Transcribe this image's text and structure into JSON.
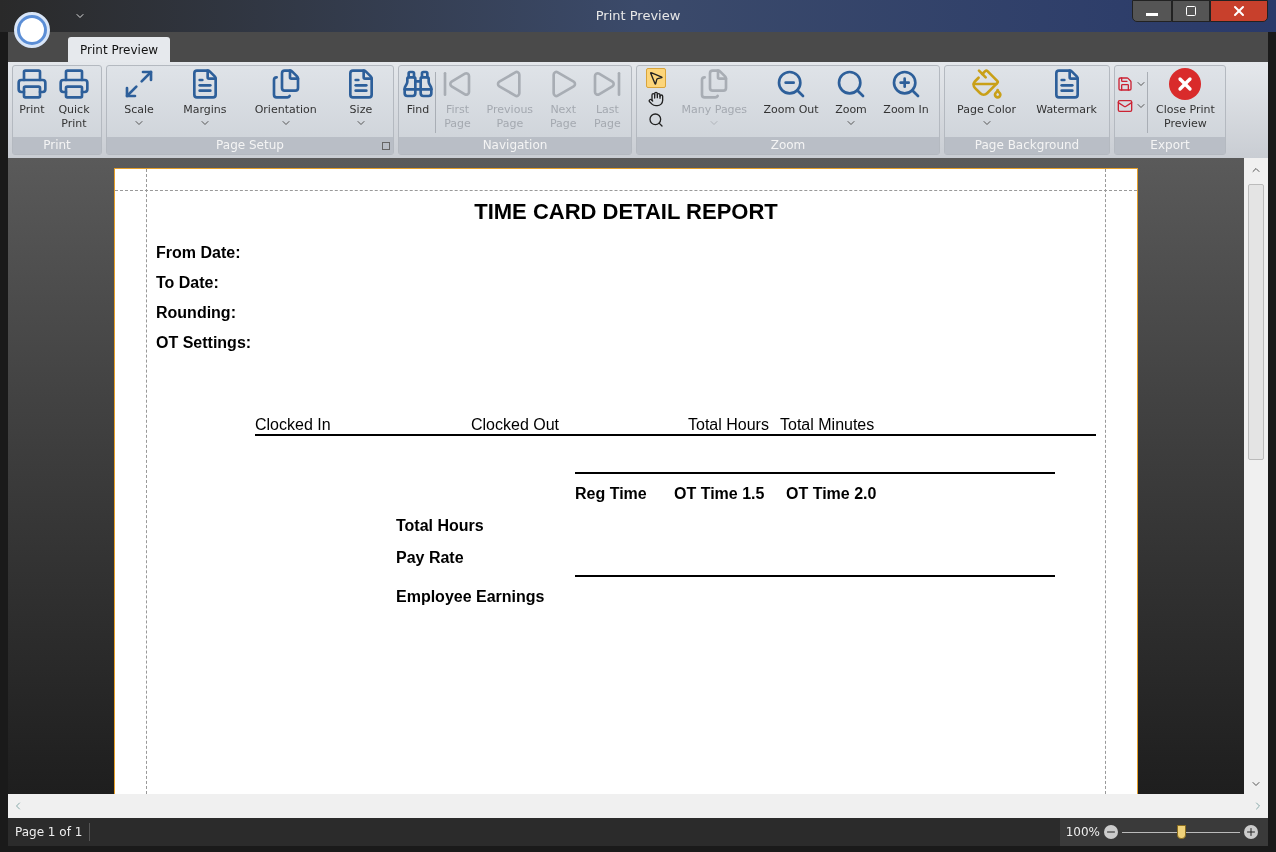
{
  "window": {
    "title": "Print Preview"
  },
  "tabs": [
    {
      "label": "Print Preview",
      "selected": true
    }
  ],
  "ribbon": [
    {
      "label": "Print",
      "has_launcher": false,
      "buttons": [
        {
          "kind": "large",
          "label": "Print",
          "disabled": false,
          "dropdown": false
        },
        {
          "kind": "large",
          "label": "Quick Print",
          "disabled": false,
          "dropdown": false
        }
      ]
    },
    {
      "label": "Page Setup",
      "has_launcher": true,
      "buttons": [
        {
          "kind": "large",
          "label": "Scale",
          "disabled": false,
          "dropdown": true
        },
        {
          "kind": "large",
          "label": "Margins",
          "disabled": false,
          "dropdown": true
        },
        {
          "kind": "large",
          "label": "Orientation",
          "disabled": false,
          "dropdown": true
        },
        {
          "kind": "large",
          "label": "Size",
          "disabled": false,
          "dropdown": true
        }
      ]
    },
    {
      "label": "Navigation",
      "has_launcher": false,
      "buttons": [
        {
          "kind": "large",
          "label": "Find",
          "disabled": false,
          "dropdown": false
        },
        {
          "kind": "separator"
        },
        {
          "kind": "large",
          "label": "First Page",
          "disabled": true,
          "dropdown": false
        },
        {
          "kind": "large",
          "label": "Previous Page",
          "disabled": true,
          "dropdown": false
        },
        {
          "kind": "large",
          "label": "Next Page",
          "disabled": true,
          "dropdown": false
        },
        {
          "kind": "large",
          "label": "Last Page",
          "disabled": true,
          "dropdown": false
        }
      ]
    },
    {
      "label": "Zoom",
      "has_launcher": false,
      "buttons": [
        {
          "kind": "tools",
          "items": [
            {
              "selected": true
            },
            {
              "selected": false
            },
            {
              "selected": false
            }
          ]
        },
        {
          "kind": "large",
          "label": "Many Pages",
          "disabled": true,
          "dropdown": true
        },
        {
          "kind": "large",
          "label": "Zoom Out",
          "disabled": false,
          "dropdown": false
        },
        {
          "kind": "large",
          "label": "Zoom",
          "disabled": false,
          "dropdown": true
        },
        {
          "kind": "large",
          "label": "Zoom In",
          "disabled": false,
          "dropdown": false
        }
      ]
    },
    {
      "label": "Page Background",
      "has_launcher": false,
      "buttons": [
        {
          "kind": "large",
          "label": "Page Color",
          "disabled": false,
          "dropdown": true
        },
        {
          "kind": "large",
          "label": "Watermark",
          "disabled": false,
          "dropdown": false
        }
      ]
    },
    {
      "label": "Export",
      "has_launcher": false,
      "buttons": [
        {
          "kind": "small-stack",
          "items": [
            {
              "dropdown": true
            },
            {
              "dropdown": true
            }
          ]
        },
        {
          "kind": "separator"
        },
        {
          "kind": "large",
          "label": "Close Print Preview",
          "disabled": false,
          "dropdown": false
        }
      ]
    }
  ],
  "report": {
    "title": "TIME CARD DETAIL REPORT",
    "fields": [
      "From Date:",
      "To Date:",
      "Rounding:",
      "OT Settings:"
    ],
    "columns": [
      "Clocked In",
      "Clocked Out",
      "Total Hours",
      "Total Minutes"
    ],
    "summary_columns": [
      "Reg Time",
      "OT Time 1.5",
      "OT Time 2.0"
    ],
    "summary_rows": [
      "Total Hours",
      "Pay Rate",
      "Employee Earnings"
    ]
  },
  "status_bar": {
    "page": "Page 1 of 1",
    "zoom": "100%",
    "zoom_slider": {
      "level": 0.5
    }
  }
}
